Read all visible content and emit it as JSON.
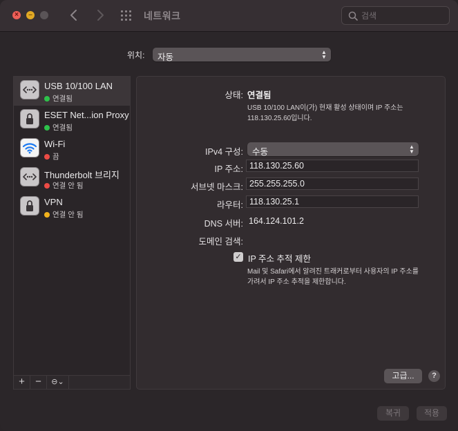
{
  "window": {
    "title": "네트워크",
    "search_placeholder": "검색"
  },
  "location": {
    "label": "위치:",
    "value": "자동"
  },
  "services": [
    {
      "name": "USB 10/100 LAN",
      "status": "연결됨",
      "status_color": "#2ec24b",
      "icon": "ethernet-icon"
    },
    {
      "name": "ESET Net...ion Proxy",
      "status": "연결됨",
      "status_color": "#2ec24b",
      "icon": "lock-icon"
    },
    {
      "name": "Wi-Fi",
      "status": "끔",
      "status_color": "#ec4b45",
      "icon": "wifi-icon"
    },
    {
      "name": "Thunderbolt 브리지",
      "status": "연결 안 됨",
      "status_color": "#ec4b45",
      "icon": "ethernet-icon"
    },
    {
      "name": "VPN",
      "status": "연결 안 됨",
      "status_color": "#f2b21c",
      "icon": "lock-icon"
    }
  ],
  "sidebar_toolbar": {
    "add": "+",
    "remove": "−",
    "action": "⊖⌄"
  },
  "detail": {
    "status_label": "상태:",
    "status_value": "연결됨",
    "status_desc_line1": "USB 10/100 LAN이(가) 현재 활성 상태이며 IP 주소는",
    "status_desc_line2": "118.130.25.60입니다.",
    "ipv4_label": "IPv4 구성:",
    "ipv4_value": "수동",
    "ip_label": "IP 주소:",
    "ip_value": "118.130.25.60",
    "subnet_label": "서브넷 마스크:",
    "subnet_value": "255.255.255.0",
    "router_label": "라우터:",
    "router_value": "118.130.25.1",
    "dns_label": "DNS 서버:",
    "dns_value": "164.124.101.2",
    "domain_label": "도메인 검색:",
    "limit_tracking_label": "IP 주소 추적 제한",
    "limit_tracking_checked": true,
    "limit_desc_line1": "Mail 및 Safari에서 알려진 트래커로부터 사용자의 IP 주소를",
    "limit_desc_line2": "가려서 IP 주소 추적을 제한합니다.",
    "advanced_button": "고급...",
    "help_button": "?"
  },
  "footer": {
    "revert_button": "복귀",
    "apply_button": "적용"
  },
  "colors": {
    "accent_green": "#2ec24b",
    "accent_red": "#ec4b45",
    "accent_yellow": "#f2b21c"
  }
}
